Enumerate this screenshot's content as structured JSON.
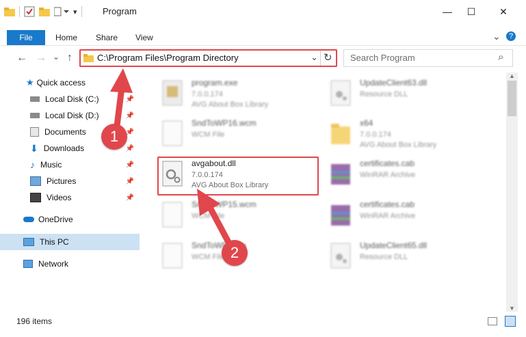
{
  "window": {
    "title": "Program",
    "minimize": "—",
    "maximize": "☐",
    "close": "✕"
  },
  "ribbon": {
    "tabs": [
      "File",
      "Home",
      "Share",
      "View"
    ],
    "help": "?",
    "expand": "⌄"
  },
  "nav": {
    "back": "←",
    "forward": "→",
    "recent": "⌄",
    "up": "↑",
    "address": "C:\\Program Files\\Program Directory",
    "address_dropdown": "⌄",
    "refresh": "↻",
    "search_placeholder": "Search Program",
    "search_icon": "⌕"
  },
  "sidebar": {
    "items": [
      {
        "label": "Quick access",
        "icon": "star-icon",
        "pinned": false
      },
      {
        "label": "Local Disk (C:)",
        "icon": "drive-icon",
        "pinned": true
      },
      {
        "label": "Local Disk (D:)",
        "icon": "drive-icon",
        "pinned": true
      },
      {
        "label": "Documents",
        "icon": "documents-icon",
        "pinned": true
      },
      {
        "label": "Downloads",
        "icon": "download-icon",
        "pinned": true
      },
      {
        "label": "Music",
        "icon": "music-icon",
        "pinned": true
      },
      {
        "label": "Pictures",
        "icon": "pictures-icon",
        "pinned": true
      },
      {
        "label": "Videos",
        "icon": "videos-icon",
        "pinned": true
      },
      {
        "label": "OneDrive",
        "icon": "cloud-icon",
        "pinned": false
      },
      {
        "label": "This PC",
        "icon": "computer-icon",
        "pinned": false,
        "selected": true
      },
      {
        "label": "Network",
        "icon": "network-icon",
        "pinned": false
      }
    ]
  },
  "files": [
    {
      "name": "program.exe",
      "line2": "7.0.0.174",
      "line3": "AVG About Box Library",
      "icon": "exe-icon"
    },
    {
      "name": "UpdateClient63.dll",
      "line2": "Resource DLL",
      "line3": "",
      "icon": "dll-icon"
    },
    {
      "name": "SndToWP16.wcm",
      "line2": "WCM File",
      "line3": "",
      "icon": "file-icon"
    },
    {
      "name": "x64",
      "line2": "7.0.0.174",
      "line3": "AVG About Box Library",
      "icon": "folder-icon"
    },
    {
      "name": "avgabout.dll",
      "line2": "7.0.0.174",
      "line3": "AVG About Box Library",
      "icon": "dll-icon"
    },
    {
      "name": "certificates.cab",
      "line2": "WinRAR Archive",
      "line3": "",
      "icon": "archive-icon"
    },
    {
      "name": "SndToWP15.wcm",
      "line2": "WCM File",
      "line3": "",
      "icon": "file-icon"
    },
    {
      "name": "certificates.cab",
      "line2": "WinRAR Archive",
      "line3": "",
      "icon": "archive-icon"
    },
    {
      "name": "SndToWP.wcm",
      "line2": "WCM File",
      "line3": "",
      "icon": "file-icon"
    },
    {
      "name": "UpdateClient65.dll",
      "line2": "Resource DLL",
      "line3": "",
      "icon": "dll-icon"
    }
  ],
  "annotations": {
    "step1": "1",
    "step2": "2"
  },
  "status": {
    "item_count": "196 items"
  },
  "colors": {
    "accent": "#1979ca",
    "highlight": "#e0474c",
    "selection": "#cce1f3"
  }
}
